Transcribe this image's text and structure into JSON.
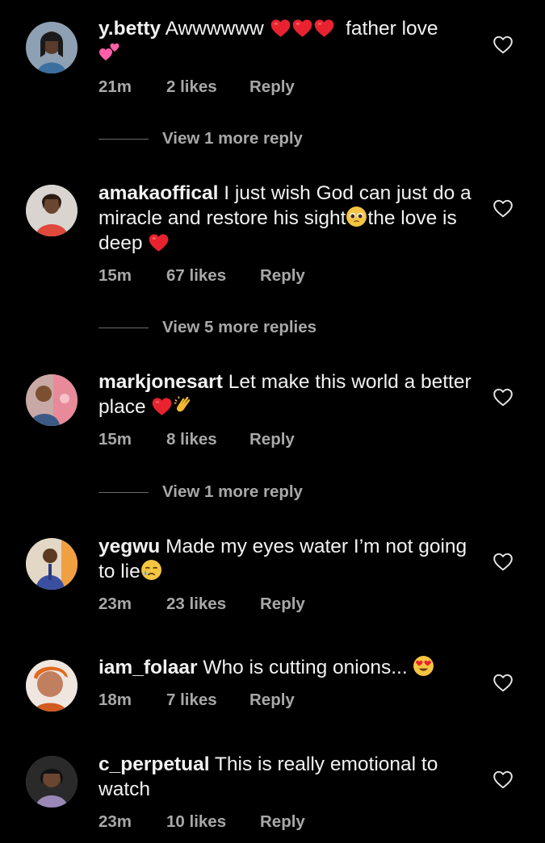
{
  "comments": [
    {
      "user": "y.betty",
      "text": "Awwwwww",
      "text2": "father love",
      "time": "21m",
      "likes": "2 likes",
      "reply": "Reply",
      "more": "View 1 more reply"
    },
    {
      "user": "amakaoffical",
      "text": "I just wish God can just do a miracle and restore his sight",
      "text2": "the love is deep",
      "time": "15m",
      "likes": "67 likes",
      "reply": "Reply",
      "more": "View 5 more replies"
    },
    {
      "user": "markjonesart",
      "text": "Let make this world a better place",
      "time": "15m",
      "likes": "8 likes",
      "reply": "Reply",
      "more": "View 1 more reply"
    },
    {
      "user": "yegwu",
      "text": "Made my eyes water I’m not going to lie",
      "time": "23m",
      "likes": "23 likes",
      "reply": "Reply"
    },
    {
      "user": "iam_folaar",
      "text": "Who is cutting onions...",
      "time": "18m",
      "likes": "7 likes",
      "reply": "Reply"
    },
    {
      "user": "c_perpetual",
      "text": "This is really emotional to watch",
      "time": "23m",
      "likes": "10 likes",
      "reply": "Reply"
    }
  ],
  "icons": {
    "like": "heart-outline-icon"
  },
  "colors": {
    "background": "#000000",
    "text": "#f2f2f2",
    "secondary": "#a8a8a8",
    "heart": "#e8232f"
  }
}
